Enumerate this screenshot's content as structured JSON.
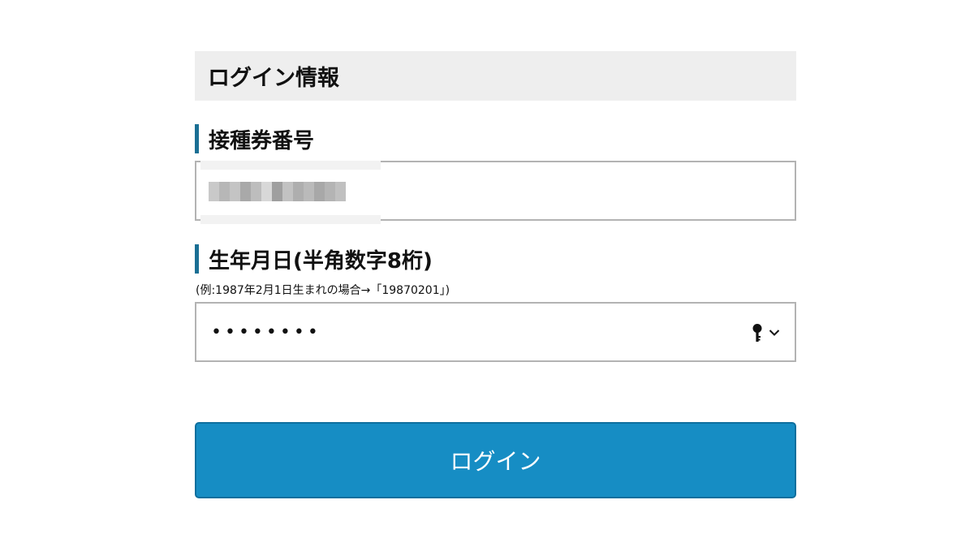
{
  "section": {
    "title": "ログイン情報"
  },
  "ticket_field": {
    "label": "接種券番号",
    "value": "",
    "redacted": true
  },
  "birthdate_field": {
    "label": "生年月日(半角数字8桁)",
    "hint": "(例:1987年2月1日生まれの場合→「19870201」)",
    "value": "••••••••",
    "icons": [
      "key-icon",
      "chevron-down-icon"
    ]
  },
  "login_button": {
    "label": "ログイン"
  },
  "colors": {
    "label_accent": "#1a6f94",
    "section_background": "#eeeeee",
    "button_background": "#168dc4",
    "input_border": "#b3b3b3"
  }
}
